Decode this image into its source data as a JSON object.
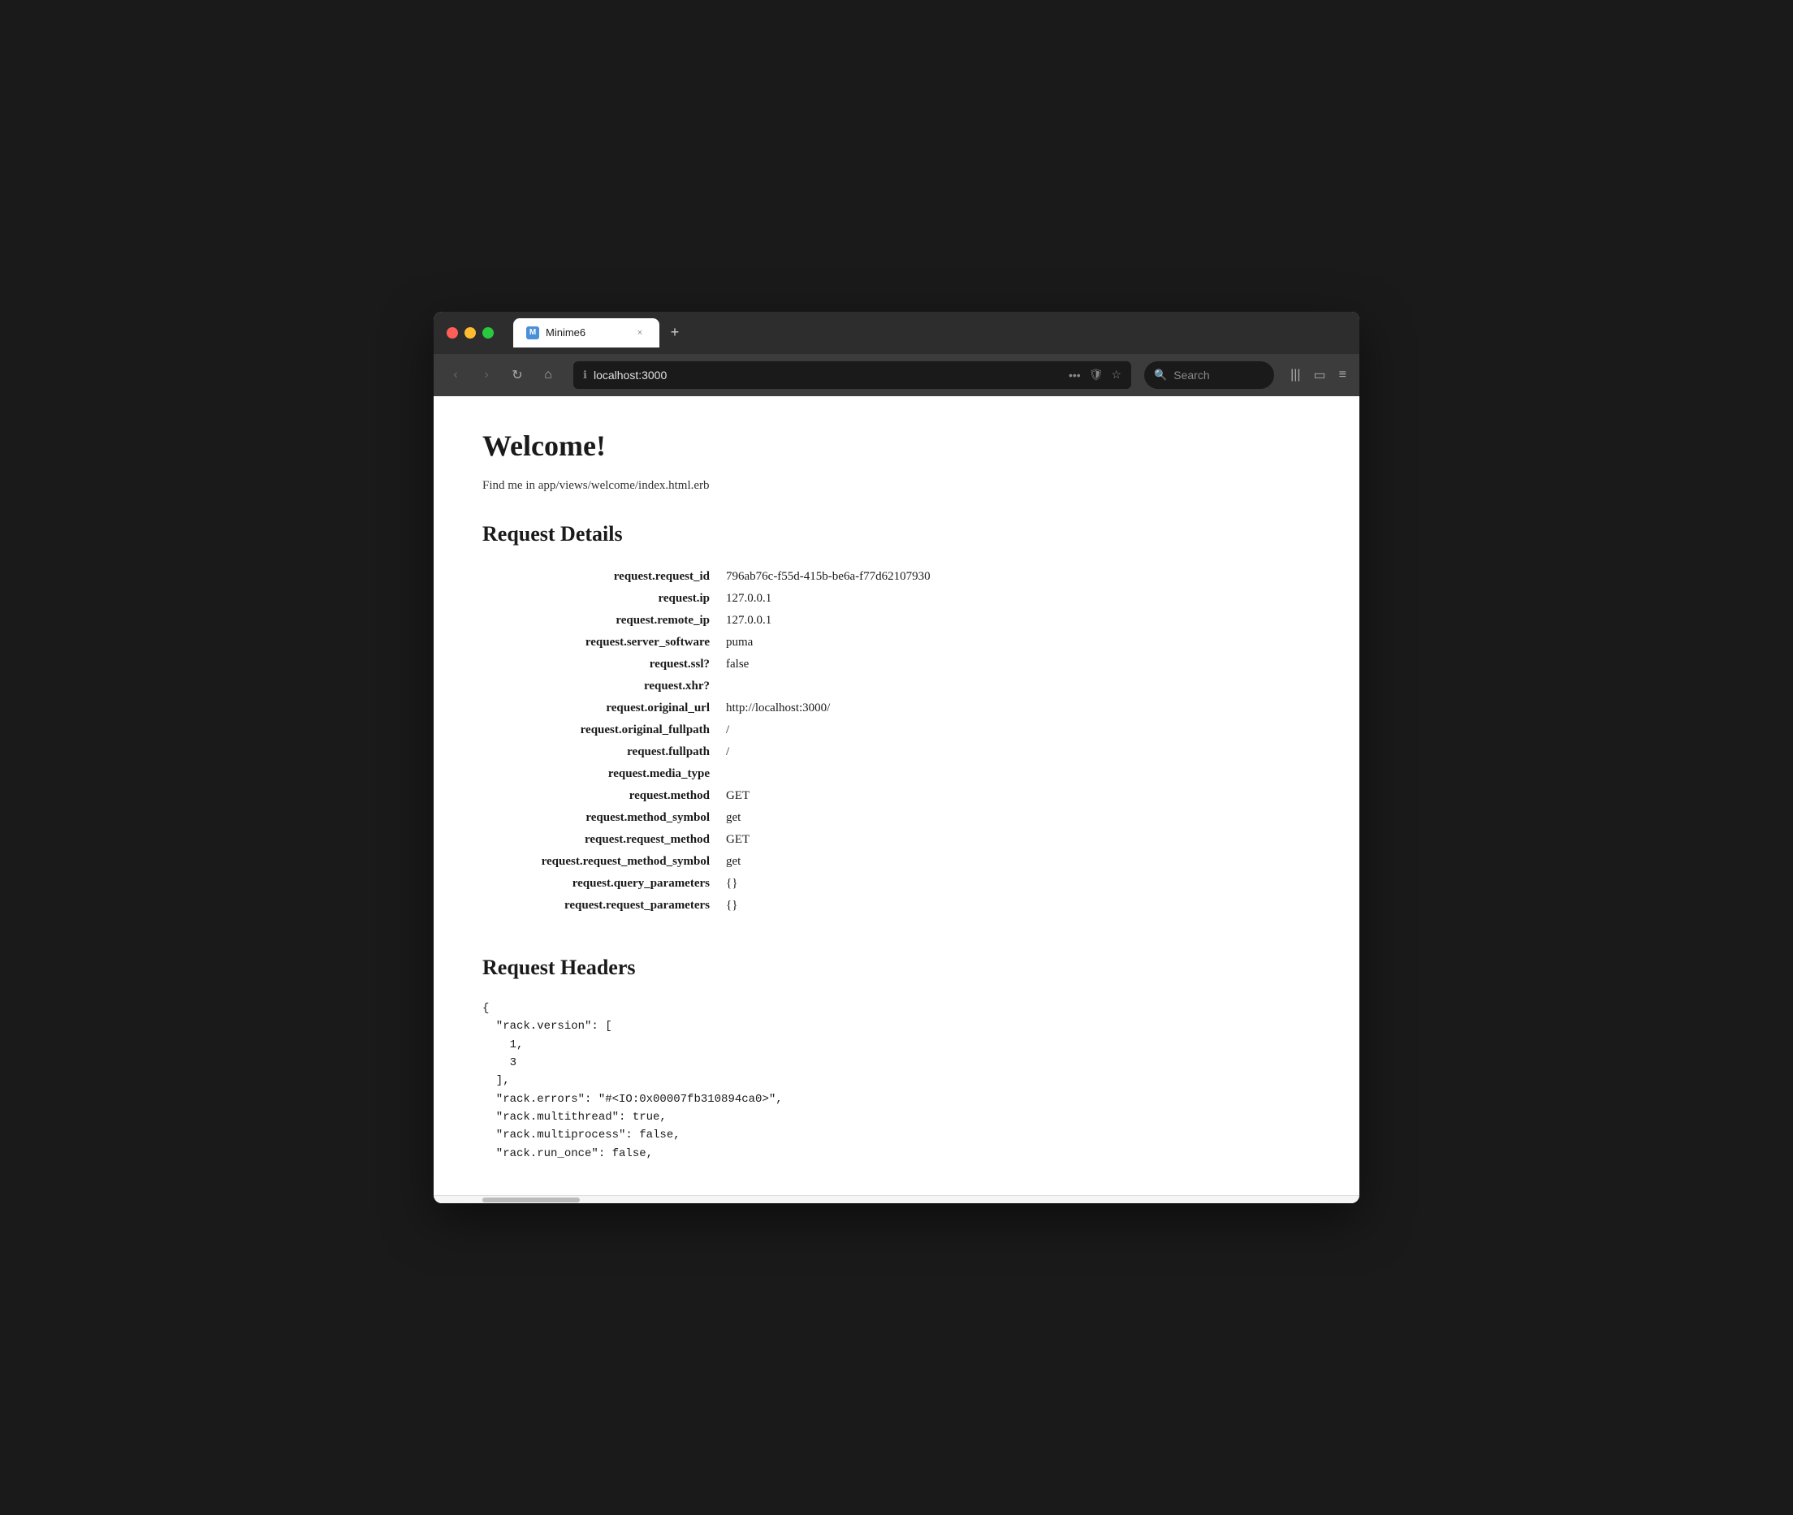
{
  "browser": {
    "tab": {
      "favicon_letter": "M",
      "title": "Minime6",
      "close_label": "×",
      "new_tab_label": "+"
    },
    "nav": {
      "back_label": "‹",
      "forward_label": "›",
      "refresh_label": "↻",
      "home_label": "⌂"
    },
    "address": {
      "icon": "ℹ",
      "url": "localhost:3000",
      "dots_label": "•••",
      "shield_label": "🛡",
      "star_label": "☆"
    },
    "search": {
      "icon": "🔍",
      "placeholder": "Search"
    },
    "toolbar_right": {
      "library_label": "|||",
      "sidebar_label": "▭",
      "menu_label": "≡"
    }
  },
  "page": {
    "title": "Welcome!",
    "subtitle": "Find me in app/views/welcome/index.html.erb",
    "request_details_heading": "Request Details",
    "request_headers_heading": "Request Headers",
    "fields": [
      {
        "label": "request.request_id",
        "value": "796ab76c-f55d-415b-be6a-f77d62107930"
      },
      {
        "label": "request.ip",
        "value": "127.0.0.1"
      },
      {
        "label": "request.remote_ip",
        "value": "127.0.0.1"
      },
      {
        "label": "request.server_software",
        "value": "puma"
      },
      {
        "label": "request.ssl?",
        "value": "false"
      },
      {
        "label": "request.xhr?",
        "value": ""
      },
      {
        "label": "request.original_url",
        "value": "http://localhost:3000/"
      },
      {
        "label": "request.original_fullpath",
        "value": "/"
      },
      {
        "label": "request.fullpath",
        "value": "/"
      },
      {
        "label": "request.media_type",
        "value": ""
      },
      {
        "label": "request.method",
        "value": "GET"
      },
      {
        "label": "request.method_symbol",
        "value": "get"
      },
      {
        "label": "request.request_method",
        "value": "GET"
      },
      {
        "label": "request.request_method_symbol",
        "value": "get"
      },
      {
        "label": "request.query_parameters",
        "value": "{}"
      },
      {
        "label": "request.request_parameters",
        "value": "{}"
      }
    ],
    "headers_code": "{\n  \"rack.version\": [\n    1,\n    3\n  ],\n  \"rack.errors\": \"#<IO:0x00007fb310894ca0>\",\n  \"rack.multithread\": true,\n  \"rack.multiprocess\": false,\n  \"rack.run_once\": false,"
  }
}
